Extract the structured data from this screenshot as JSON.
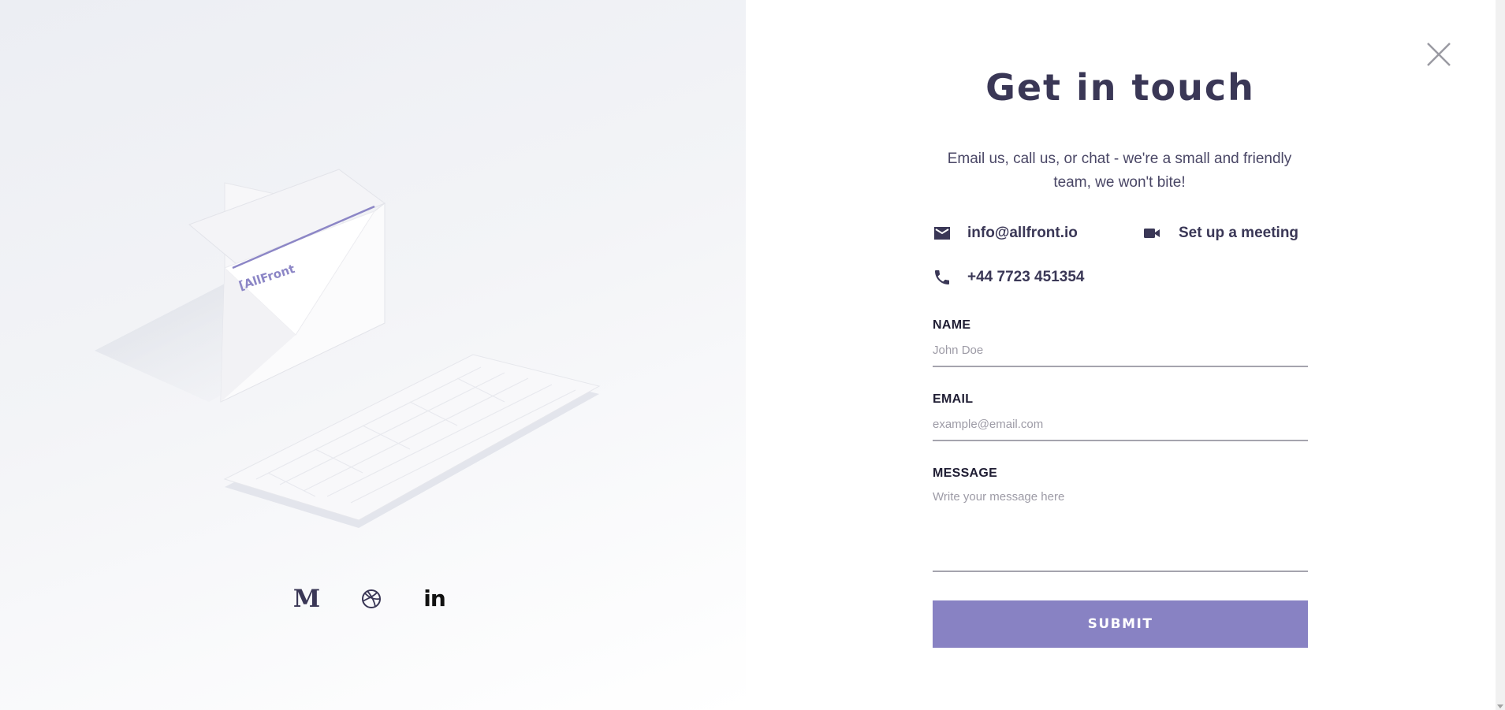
{
  "page": {
    "title": "Get in touch",
    "subtitle": "Email us, call us, or chat - we're a small and friendly team, we won't bite!"
  },
  "contacts": {
    "email": {
      "label": "info@allfront.io",
      "icon": "mail-icon"
    },
    "meeting": {
      "label": "Set up a meeting",
      "icon": "video-camera-icon"
    },
    "phone": {
      "label": "+44 7723 451354",
      "icon": "phone-icon"
    }
  },
  "illustration": {
    "logo_text": "[AllFront"
  },
  "form": {
    "name": {
      "label": "NAME",
      "placeholder": "John Doe"
    },
    "email": {
      "label": "EMAIL",
      "placeholder": "example@email.com"
    },
    "message": {
      "label": "MESSAGE",
      "placeholder": "Write your message here"
    },
    "submit_label": "SUBMIT"
  },
  "socials": [
    {
      "name": "medium",
      "icon": "medium-icon",
      "glyph": "M"
    },
    {
      "name": "dribbble",
      "icon": "dribbble-icon"
    },
    {
      "name": "linkedin",
      "icon": "linkedin-icon",
      "glyph": "in"
    }
  ],
  "colors": {
    "accent": "#8882c3",
    "text": "#3a3756",
    "left_panel_bg": "#eef0f4"
  }
}
